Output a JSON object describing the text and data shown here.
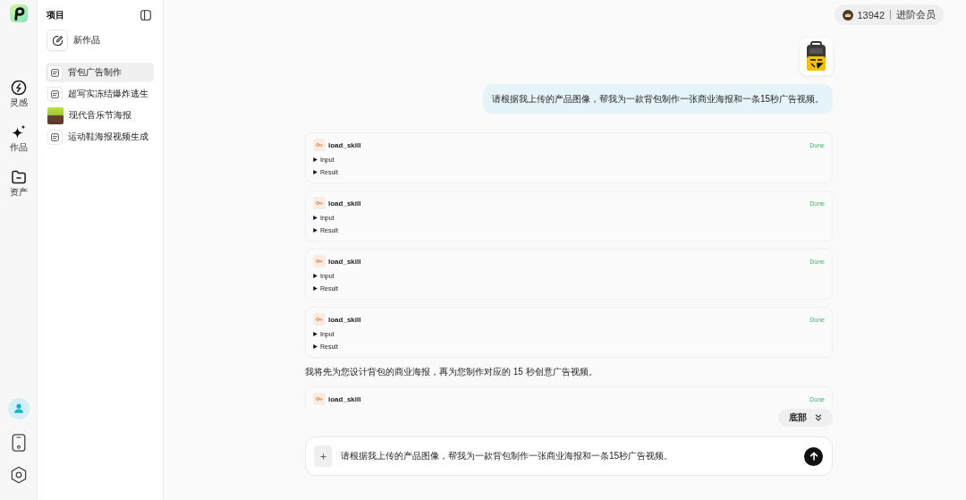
{
  "rail": {
    "items": [
      {
        "label": "灵感"
      },
      {
        "label": "作品"
      },
      {
        "label": "资产"
      }
    ]
  },
  "sidebar": {
    "title": "项目",
    "new_button": "新作品",
    "items": [
      {
        "label": "背包广告制作",
        "kind": "doc",
        "selected": true
      },
      {
        "label": "超写实冻结爆炸逃生",
        "kind": "doc",
        "selected": false
      },
      {
        "label": "现代音乐节海报",
        "kind": "thumbnail",
        "selected": false
      },
      {
        "label": "运动鞋海报视频生成",
        "kind": "doc",
        "selected": false
      }
    ]
  },
  "header": {
    "points": "13942",
    "membership": "进阶会员"
  },
  "chat": {
    "messages": [
      {
        "kind": "attachment"
      },
      {
        "kind": "user_text",
        "text": "请根据我上传的产品图像，帮我为一款背包制作一张商业海报和一条15秒广告视频。"
      },
      {
        "kind": "tool_call",
        "name": "load_skill",
        "status": "Done",
        "sections": [
          {
            "label": "Input",
            "expanded": false
          },
          {
            "label": "Result",
            "expanded": false
          }
        ]
      },
      {
        "kind": "tool_call",
        "name": "load_skill",
        "status": "Done",
        "sections": [
          {
            "label": "Input",
            "expanded": false
          },
          {
            "label": "Result",
            "expanded": false
          }
        ]
      },
      {
        "kind": "tool_call",
        "name": "load_skill",
        "status": "Done",
        "sections": [
          {
            "label": "Input",
            "expanded": false
          },
          {
            "label": "Result",
            "expanded": false
          }
        ]
      },
      {
        "kind": "tool_call",
        "name": "load_skill",
        "status": "Done",
        "sections": [
          {
            "label": "Input",
            "expanded": false
          },
          {
            "label": "Result",
            "expanded": false
          }
        ]
      },
      {
        "kind": "assistant_text",
        "text": "我将先为您设计背包的商业海报，再为您制作对应的 15 秒创意广告视频。"
      },
      {
        "kind": "tool_call",
        "name": "load_skill",
        "status": "Done"
      }
    ]
  },
  "scroll_button": {
    "label": "底部"
  },
  "composer": {
    "value": "请根据我上传的产品图像，帮我为一款背包制作一张商业海报和一条15秒广告视频。"
  }
}
